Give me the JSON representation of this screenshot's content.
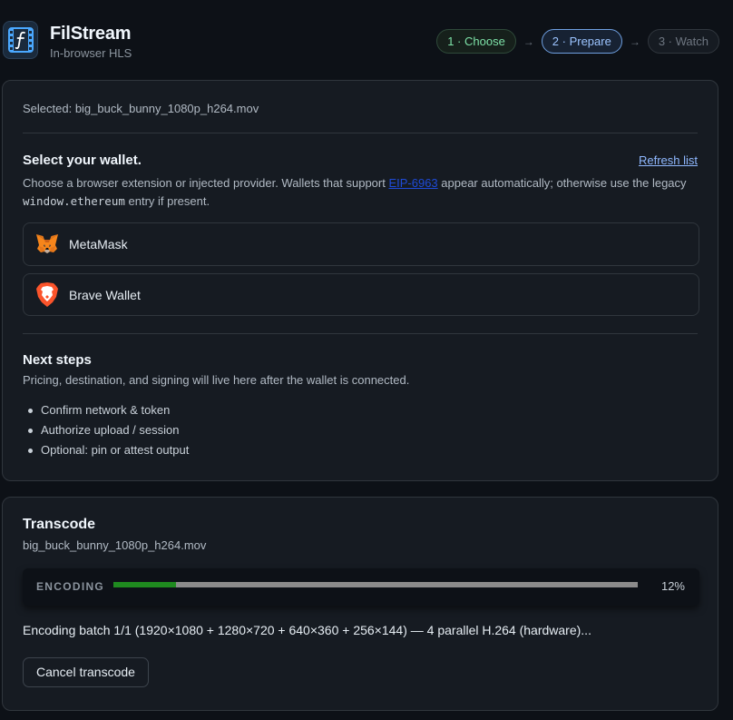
{
  "brand": {
    "title": "FilStream",
    "subtitle": "In-browser HLS",
    "logo_icon": "film-function-icon"
  },
  "steps": [
    {
      "label": "1 · Choose",
      "state": "done"
    },
    {
      "label": "2 · Prepare",
      "state": "active"
    },
    {
      "label": "3 · Watch",
      "state": "pending"
    }
  ],
  "prepare": {
    "selected_text": "Selected: big_buck_bunny_1080p_h264.mov",
    "wallet": {
      "title": "Select your wallet.",
      "refresh_label": "Refresh list",
      "desc_part1": "Choose a browser extension or injected provider. Wallets that support ",
      "desc_link": "EIP-6963",
      "desc_part2": " appear automatically; otherwise use the legacy ",
      "desc_code": "window.ethereum",
      "desc_part3": " entry if present.",
      "options": [
        {
          "name": "MetaMask",
          "icon": "metamask-fox-icon"
        },
        {
          "name": "Brave Wallet",
          "icon": "brave-lion-icon"
        }
      ]
    },
    "next_steps": {
      "title": "Next steps",
      "desc": "Pricing, destination, and signing will live here after the wallet is connected.",
      "items": [
        "Confirm network & token",
        "Authorize upload / session",
        "Optional: pin or attest output"
      ]
    }
  },
  "transcode": {
    "title": "Transcode",
    "file": "big_buck_bunny_1080p_h264.mov",
    "progress_label": "ENCODING",
    "progress_percent": 12,
    "progress_text": "12%",
    "status": "Encoding batch 1/1 (1920×1080 + 1280×720 + 640×360 + 256×144) — 4 parallel H.264 (hardware)...",
    "cancel_label": "Cancel transcode"
  },
  "colors": {
    "background": "#0d1117",
    "card": "#161b22",
    "progress_fill": "#1f8a1f",
    "step_done": "#7ee2a8",
    "step_active": "#9cc4ff"
  }
}
